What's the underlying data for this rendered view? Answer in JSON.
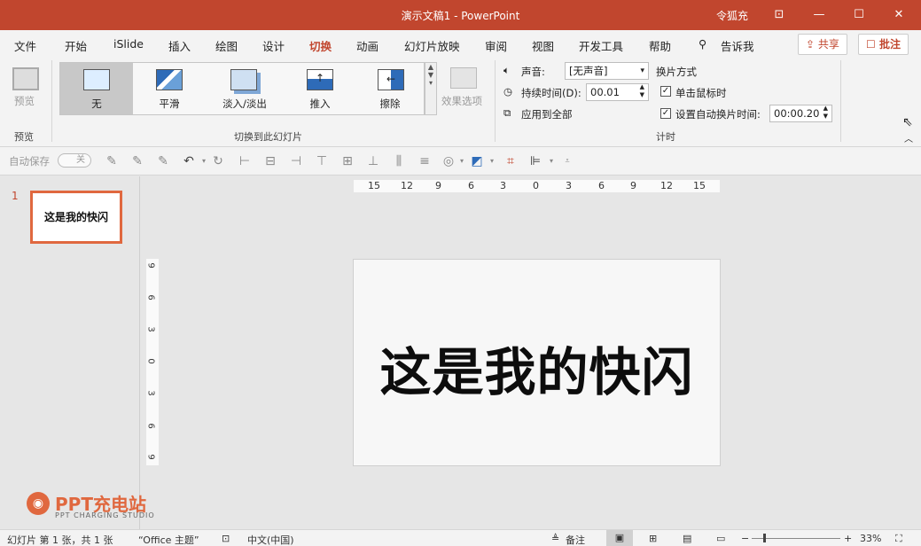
{
  "window": {
    "title": "演示文稿1  -  PowerPoint",
    "user": "令狐充"
  },
  "tabs": [
    "文件",
    "开始",
    "iSlide",
    "插入",
    "绘图",
    "设计",
    "切换",
    "动画",
    "幻灯片放映",
    "审阅",
    "视图",
    "开发工具",
    "帮助"
  ],
  "active_tab": "切换",
  "tell_me": "告诉我",
  "share": "共享",
  "comment": "批注",
  "ribbon": {
    "preview_label": "预览",
    "preview_group": "预览",
    "transitions": [
      "无",
      "平滑",
      "淡入/淡出",
      "推入",
      "擦除"
    ],
    "effect_options": "效果选项",
    "transitions_group": "切换到此幻灯片",
    "sound_label": "声音:",
    "sound_value": "[无声音]",
    "duration_label": "持续时间(D):",
    "duration_value": "00.01",
    "apply_all": "应用到全部",
    "advance_label": "换片方式",
    "on_click": "单击鼠标时",
    "after_label": "设置自动换片时间:",
    "after_value": "00:00.20",
    "timing_group": "计时"
  },
  "qat": {
    "autosave": "自动保存",
    "autosave_state": "关"
  },
  "slides": {
    "number": "1",
    "thumb_text": "这是我的快闪"
  },
  "rulers": {
    "h": [
      "15",
      "12",
      "9",
      "6",
      "3",
      "0",
      "3",
      "6",
      "9",
      "12",
      "15"
    ],
    "v": [
      "9",
      "6",
      "3",
      "0",
      "3",
      "6",
      "9"
    ]
  },
  "slide": {
    "text": "这是我的快闪"
  },
  "logo": {
    "main": "PPT充电站",
    "sub": "PPT CHARGING STUDIO"
  },
  "status": {
    "slide_info": "幻灯片 第 1 张，共 1 张",
    "theme": "“Office 主题”",
    "lang": "中文(中国)",
    "notes": "备注",
    "zoom": "33%"
  },
  "colors": {
    "accent": "#c1462e",
    "thumb_border": "#e0683f"
  }
}
